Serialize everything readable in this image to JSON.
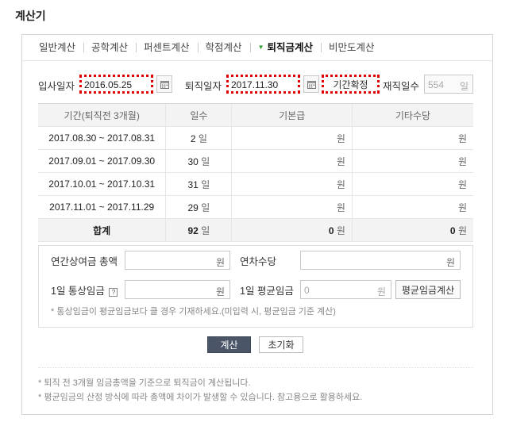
{
  "app": {
    "title": "계산기"
  },
  "tabs": [
    {
      "label": "일반계산",
      "active": false
    },
    {
      "label": "공학계산",
      "active": false
    },
    {
      "label": "퍼센트계산",
      "active": false
    },
    {
      "label": "학점계산",
      "active": false
    },
    {
      "label": "퇴직금계산",
      "active": true
    },
    {
      "label": "비만도계산",
      "active": false
    }
  ],
  "form": {
    "start_label": "입사일자",
    "start_value": "2016.05.25",
    "end_label": "퇴직일자",
    "end_value": "2017.11.30",
    "confirm_button": "기간확정",
    "tenure_label": "재직일수",
    "tenure_value": "554",
    "tenure_unit": "일"
  },
  "table": {
    "headers": [
      "기간(퇴직전 3개월)",
      "일수",
      "기본급",
      "기타수당"
    ],
    "rows": [
      {
        "period": "2017.08.30 ~ 2017.08.31",
        "days": "2",
        "base": "",
        "extra": ""
      },
      {
        "period": "2017.09.01 ~ 2017.09.30",
        "days": "30",
        "base": "",
        "extra": ""
      },
      {
        "period": "2017.10.01 ~ 2017.10.31",
        "days": "31",
        "base": "",
        "extra": ""
      },
      {
        "period": "2017.11.01 ~ 2017.11.29",
        "days": "29",
        "base": "",
        "extra": ""
      }
    ],
    "day_unit": "일",
    "won_unit": "원",
    "total": {
      "label": "합계",
      "days": "92",
      "base": "0",
      "extra": "0"
    }
  },
  "extra": {
    "bonus_label": "연간상여금 총액",
    "annual_leave_label": "연차수당",
    "ordinary_wage_label": "1일 통상임금",
    "help_mark": "?",
    "avg_wage_label": "1일 평균임금",
    "avg_wage_value": "0",
    "avg_calc_button": "평균임금계산",
    "won_unit": "원",
    "note": "* 통상임금이 평균임금보다 클 경우 기재하세요.(미입력 시, 평균임금 기준 계산)"
  },
  "actions": {
    "calc": "계산",
    "reset": "초기화"
  },
  "footer": [
    "* 퇴직 전 3개월 임금총액을 기준으로 퇴직금이 계산됩니다.",
    "* 평균임금의 산정 방식에 따라 총액에 차이가 발생할 수 있습니다. 참고용으로 활용하세요."
  ]
}
